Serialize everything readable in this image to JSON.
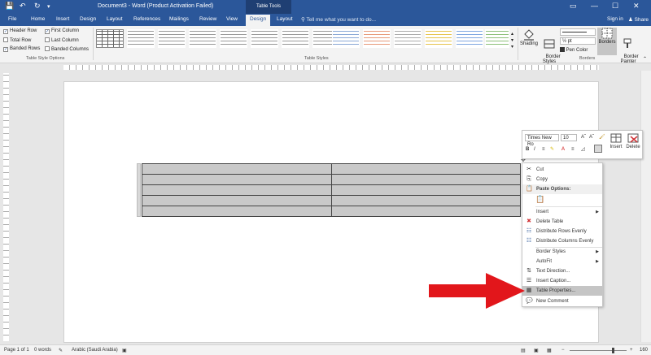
{
  "titlebar": {
    "title": "Document3 - Word (Product Activation Failed)",
    "tool_tab": "Table Tools",
    "minimize": "—",
    "restore": "☐",
    "close": "✕",
    "save_icon": "💾",
    "undo_icon": "↶",
    "redo_icon": "↻"
  },
  "tabs": [
    "File",
    "Home",
    "Insert",
    "Design",
    "Layout",
    "References",
    "Mailings",
    "Review",
    "View",
    "Design",
    "Layout"
  ],
  "tell_me": "Tell me what you want to do...",
  "sign_in": "Sign in",
  "share": "Share",
  "style_options": {
    "items": [
      {
        "label": "Header Row",
        "checked": true
      },
      {
        "label": "First Column",
        "checked": true
      },
      {
        "label": "Total Row",
        "checked": false
      },
      {
        "label": "Last Column",
        "checked": false
      },
      {
        "label": "Banded Rows",
        "checked": true
      },
      {
        "label": "Banded Columns",
        "checked": false
      }
    ],
    "group_label": "Table Style Options",
    "check_mark": "✓"
  },
  "table_styles": {
    "group_label": "Table Styles"
  },
  "shading": {
    "label": "Shading"
  },
  "border_styles": {
    "label": "Border\nStyles"
  },
  "pen_weight": "½ pt",
  "pen_color": "Pen Color",
  "borders_btn": "Borders",
  "border_painter": "Border\nPainter",
  "borders_group_label": "Borders",
  "status": {
    "page": "Page 1 of 1",
    "words": "0 words",
    "language": "Arabic (Saudi Arabia)",
    "zoom": "160"
  },
  "mini_toolbar": {
    "font": "Times New Ro",
    "size": "10",
    "insert": "Insert",
    "delete": "Delete",
    "bold": "B",
    "italic": "I"
  },
  "context_menu": {
    "items": [
      {
        "label": "Cut",
        "icon": "✂"
      },
      {
        "label": "Copy",
        "icon": "⎘"
      },
      {
        "label": "Paste Options:",
        "icon": "📋"
      },
      {
        "label": "Insert",
        "icon": ""
      },
      {
        "label": "Delete Table",
        "icon": "✖"
      },
      {
        "label": "Distribute Rows Evenly",
        "icon": "☷"
      },
      {
        "label": "Distribute Columns Evenly",
        "icon": "☷"
      },
      {
        "label": "Border Styles",
        "icon": ""
      },
      {
        "label": "AutoFit",
        "icon": ""
      },
      {
        "label": "Text Direction...",
        "icon": "⇅"
      },
      {
        "label": "Insert Caption...",
        "icon": "☰"
      },
      {
        "label": "Table Properties...",
        "icon": "▦"
      },
      {
        "label": "New Comment",
        "icon": "💬"
      }
    ]
  },
  "colors": {
    "accent": "#2b579a",
    "arrow": "#e2161b",
    "highlight": "#c5c5c5"
  }
}
